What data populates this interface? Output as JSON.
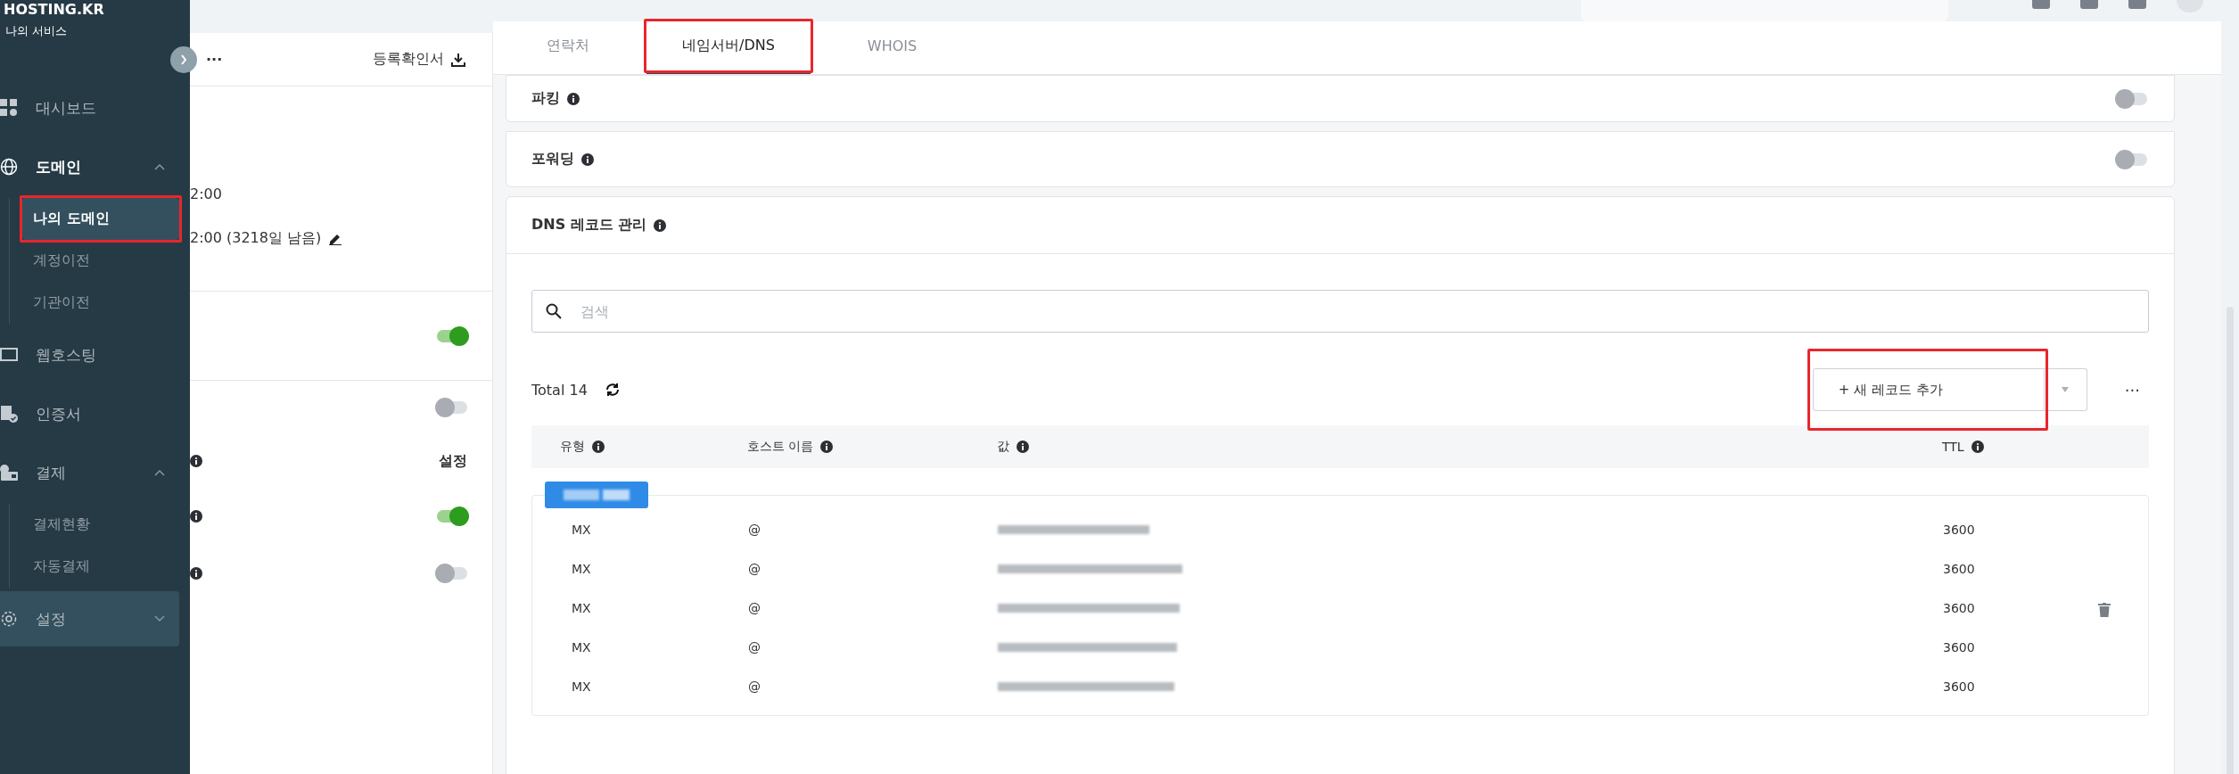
{
  "sidebar": {
    "logo": "HOSTING.KR",
    "subtitle": "나의 서비스",
    "items": [
      {
        "label": "대시보드",
        "selected": false
      },
      {
        "label": "도메인",
        "expanded": true,
        "selected": true,
        "children": [
          {
            "label": "나의 도메인",
            "selected": true,
            "highlighted": true
          },
          {
            "label": "계정이전",
            "selected": false,
            "highlighted": false
          },
          {
            "label": "기관이전",
            "selected": false,
            "highlighted": false
          }
        ]
      },
      {
        "label": "웹호스팅",
        "selected": false
      },
      {
        "label": "인증서",
        "selected": false
      },
      {
        "label": "결제",
        "expanded": true,
        "selected": false,
        "children": [
          {
            "label": "결제현황",
            "selected": false,
            "highlighted": false
          },
          {
            "label": "자동결제",
            "selected": false,
            "highlighted": false
          }
        ]
      },
      {
        "label": "설정",
        "selected": true
      }
    ]
  },
  "detail_panel": {
    "more": "···",
    "certificate_link": "등록확인서",
    "created": "2:00",
    "expires": "2:00 (3218일 남음)",
    "toggles": [
      {
        "on": true
      },
      {
        "on": false
      }
    ],
    "settings_label": "설정",
    "options": [
      {
        "on": true
      },
      {
        "on": false
      }
    ]
  },
  "tabs": [
    {
      "label": "연락처",
      "selected": false,
      "highlighted": false
    },
    {
      "label": "네임서버/DNS",
      "selected": true,
      "highlighted": true
    },
    {
      "label": "WHOIS",
      "selected": false,
      "highlighted": false
    }
  ],
  "sections": [
    {
      "title": "파킹",
      "on": false
    },
    {
      "title": "포워딩",
      "on": false
    }
  ],
  "dns": {
    "title": "DNS 레코드 관리",
    "search": {
      "placeholder": "검색"
    },
    "total": "Total 14",
    "add_button": {
      "label": "+ 새 레코드 추가",
      "highlighted": true
    },
    "more": "···",
    "columns": [
      "유형",
      "호스트 이름",
      "값",
      "TTL"
    ],
    "rows": [
      {
        "type": "MX",
        "host": "@",
        "ttl": "3600"
      },
      {
        "type": "MX",
        "host": "@",
        "ttl": "3600"
      },
      {
        "type": "MX",
        "host": "@",
        "ttl": "3600"
      },
      {
        "type": "MX",
        "host": "@",
        "ttl": "3600"
      },
      {
        "type": "MX",
        "host": "@",
        "ttl": "3600"
      }
    ]
  }
}
